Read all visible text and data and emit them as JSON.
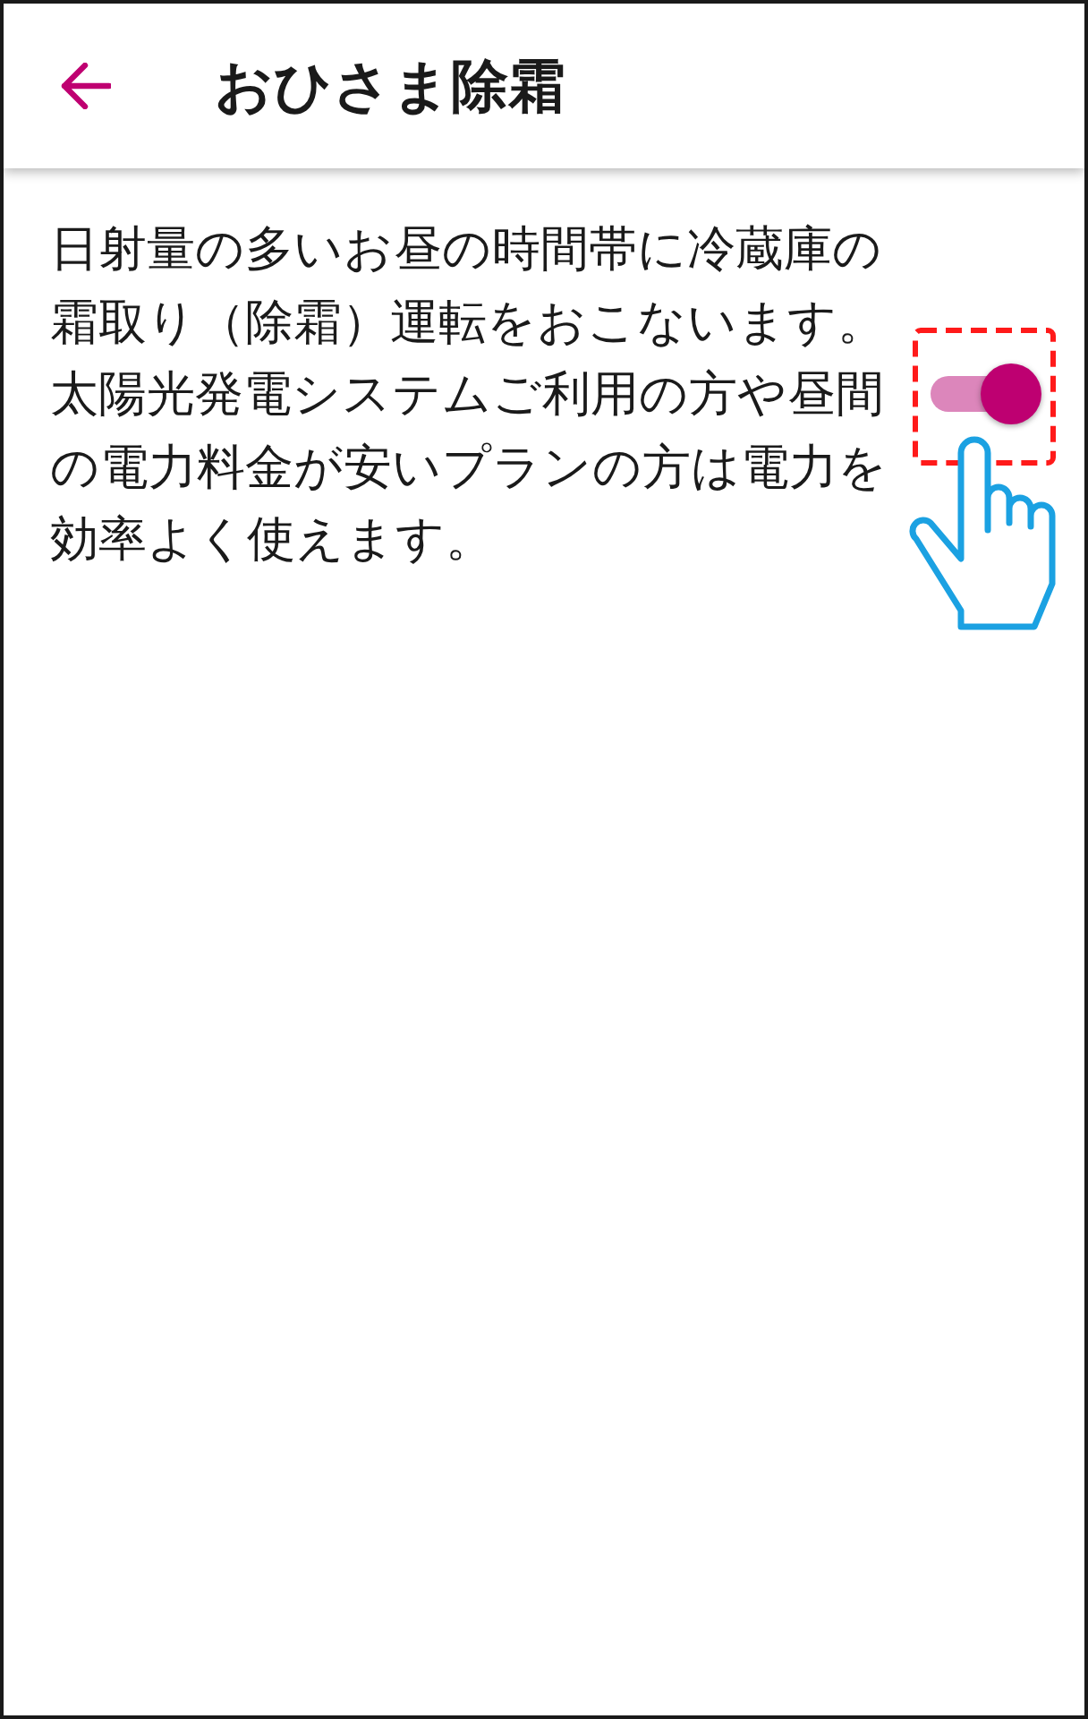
{
  "app_bar": {
    "title": "おひさま除霜"
  },
  "setting": {
    "description": "日射量の多いお昼の時間帯に冷蔵庫の霜取り（除霜）運転をおこないます。太陽光発電システムご利用の方や昼間の電力料金が安いプランの方は電力を効率よく使えます。",
    "on": true
  }
}
